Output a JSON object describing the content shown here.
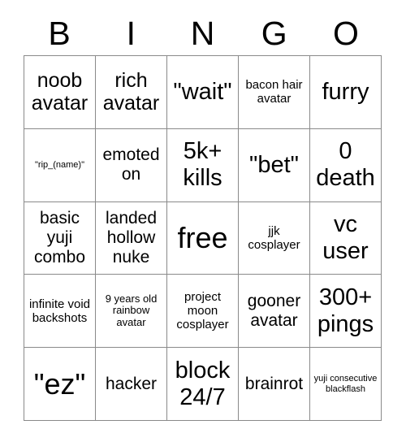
{
  "card": {
    "header_letters": [
      "B",
      "I",
      "N",
      "G",
      "O"
    ],
    "rows": [
      [
        {
          "text": "noob avatar",
          "size": "fs-l"
        },
        {
          "text": "rich avatar",
          "size": "fs-l"
        },
        {
          "text": "\"wait\"",
          "size": "fs-xl"
        },
        {
          "text": "bacon hair avatar",
          "size": "fs-s"
        },
        {
          "text": "furry",
          "size": "fs-xl"
        }
      ],
      [
        {
          "text": "\"rip_(name)\"",
          "size": "fs-xxs"
        },
        {
          "text": "emoted on",
          "size": "fs-m"
        },
        {
          "text": "5k+ kills",
          "size": "fs-xl"
        },
        {
          "text": "\"bet\"",
          "size": "fs-xl"
        },
        {
          "text": "0 death",
          "size": "fs-xl"
        }
      ],
      [
        {
          "text": "basic yuji combo",
          "size": "fs-m"
        },
        {
          "text": "landed hollow nuke",
          "size": "fs-m"
        },
        {
          "text": "free",
          "size": "fs-xxl"
        },
        {
          "text": "jjk cosplayer",
          "size": "fs-s"
        },
        {
          "text": "vc user",
          "size": "fs-xl"
        }
      ],
      [
        {
          "text": "infinite void backshots",
          "size": "fs-s"
        },
        {
          "text": "9 years old rainbow avatar",
          "size": "fs-xs"
        },
        {
          "text": "project moon cosplayer",
          "size": "fs-s"
        },
        {
          "text": "gooner avatar",
          "size": "fs-m"
        },
        {
          "text": "300+ pings",
          "size": "fs-xl"
        }
      ],
      [
        {
          "text": "\"ez\"",
          "size": "fs-xxl"
        },
        {
          "text": "hacker",
          "size": "fs-m"
        },
        {
          "text": "block 24/7",
          "size": "fs-xl"
        },
        {
          "text": "brainrot",
          "size": "fs-m"
        },
        {
          "text": "yuji consecutive blackflash",
          "size": "fs-xxs"
        }
      ]
    ]
  },
  "style": {
    "background_color": "#ffffff",
    "text_color": "#000000",
    "border_color": "#8a8a8a"
  }
}
